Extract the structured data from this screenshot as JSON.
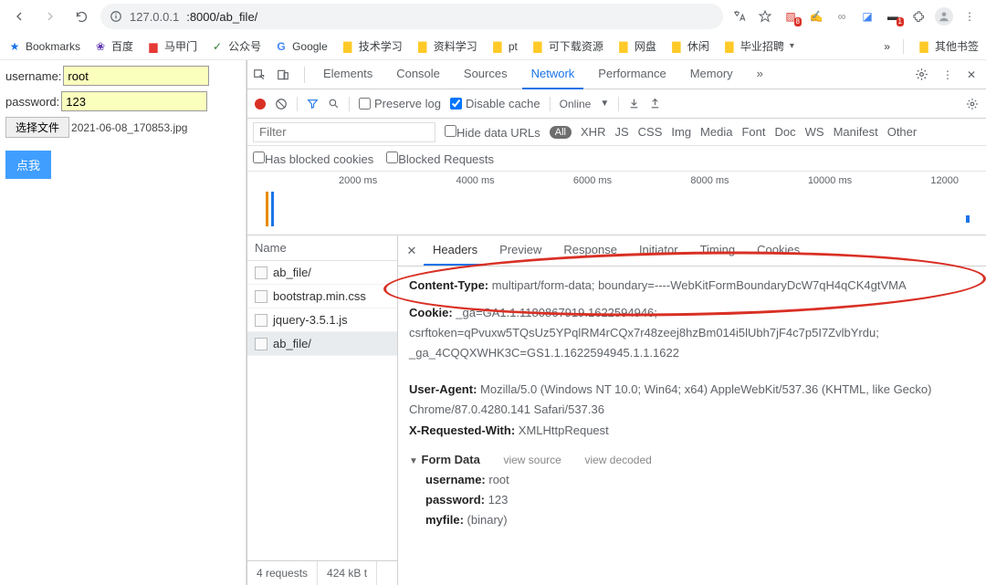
{
  "browser": {
    "url_host": "127.0.0.1",
    "url_path": ":8000/ab_file/",
    "ext_badges": [
      "8",
      "",
      "",
      "",
      "1",
      "",
      ""
    ]
  },
  "bookmarks": {
    "label": "Bookmarks",
    "items": [
      "百度",
      "马甲门",
      "公众号",
      "Google",
      "技术学习",
      "资料学习",
      "pt",
      "可下载资源",
      "网盘",
      "休闲",
      "毕业招聘"
    ],
    "overflow": "»",
    "other": "其他书签"
  },
  "page": {
    "username_label": "username:",
    "username_value": "root",
    "password_label": "password:",
    "password_value": "123",
    "file_button": "选择文件",
    "file_name": "2021-06-08_170853.jpg",
    "submit": "点我"
  },
  "devtools": {
    "tabs": [
      "Elements",
      "Console",
      "Sources",
      "Network",
      "Performance",
      "Memory"
    ],
    "active_tab": 3,
    "more": "»",
    "controls": {
      "preserve_log": "Preserve log",
      "disable_cache": "Disable cache",
      "disable_cache_checked": true,
      "throttle": "Online"
    },
    "filter": {
      "placeholder": "Filter",
      "hide_data_urls": "Hide data URLs",
      "all": "All",
      "types": [
        "XHR",
        "JS",
        "CSS",
        "Img",
        "Media",
        "Font",
        "Doc",
        "WS",
        "Manifest",
        "Other"
      ]
    },
    "filter2": {
      "blocked_cookies": "Has blocked cookies",
      "blocked_requests": "Blocked Requests"
    },
    "timeline": [
      "2000 ms",
      "4000 ms",
      "6000 ms",
      "8000 ms",
      "10000 ms",
      "12000"
    ],
    "requests": {
      "header": "Name",
      "items": [
        "ab_file/",
        "bootstrap.min.css",
        "jquery-3.5.1.js",
        "ab_file/"
      ],
      "selected": 3,
      "status": {
        "count": "4 requests",
        "size": "424 kB t"
      }
    },
    "detail": {
      "tabs": [
        "Headers",
        "Preview",
        "Response",
        "Initiator",
        "Timing",
        "Cookies"
      ],
      "active": 0,
      "headers": {
        "content_type_label": "Content-Type:",
        "content_type_value": "multipart/form-data; boundary=----WebKitFormBoundaryDcW7qH4qCK4gtVMA",
        "cookie_label": "Cookie:",
        "cookie_value": "_ga=GA1.1.1180867919.1622594946; csrftoken=qPvuxw5TQsUz5YPqlRM4rCQx7r48zeej8hzBm014i5lUbh7jF4c7p5I7ZvlbYrdu; _ga_4CQQXWHK3C=GS1.1.1622594945.1.1.1622",
        "ua_label": "User-Agent:",
        "ua_value": "Mozilla/5.0 (Windows NT 10.0; Win64; x64) AppleWebKit/537.36 (KHTML, like Gecko) Chrome/87.0.4280.141 Safari/537.36",
        "xreq_label": "X-Requested-With:",
        "xreq_value": "XMLHttpRequest"
      },
      "form_data": {
        "title": "Form Data",
        "view_source": "view source",
        "view_decoded": "view decoded",
        "rows": {
          "username_k": "username:",
          "username_v": "root",
          "password_k": "password:",
          "password_v": "123",
          "myfile_k": "myfile:",
          "myfile_v": "(binary)"
        }
      }
    }
  }
}
